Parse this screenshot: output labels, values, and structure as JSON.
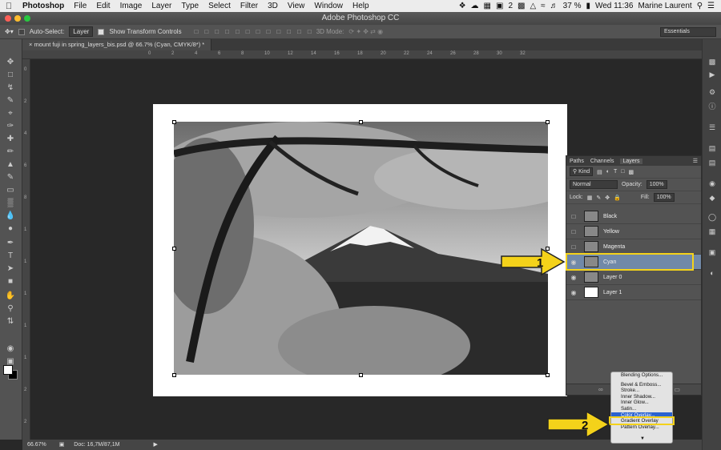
{
  "menubar": {
    "app": "Photoshop",
    "items": [
      "File",
      "Edit",
      "Image",
      "Layer",
      "Type",
      "Select",
      "Filter",
      "3D",
      "View",
      "Window",
      "Help"
    ],
    "battery": "37 %",
    "clock": "Wed 11:36",
    "user": "Marine Laurent",
    "badge": "2"
  },
  "window": {
    "title": "Adobe Photoshop CC"
  },
  "options": {
    "auto_select": "Auto-Select:",
    "layer_select": "Layer",
    "transform_controls": "Show Transform Controls",
    "mode_3d": "3D Mode:",
    "workspace": "Essentials"
  },
  "document": {
    "tab": "mount fuji in spring_layers_bis.psd @ 66.7% (Cyan, CMYK/8*) *",
    "zoom": "66.67%",
    "doc_size": "Doc: 16,7M/87,1M"
  },
  "ruler": {
    "top": [
      "0",
      "2",
      "4",
      "6",
      "8",
      "10",
      "12",
      "14",
      "16",
      "18",
      "20",
      "22",
      "24",
      "26",
      "28",
      "30",
      "32"
    ],
    "left": [
      "0",
      "2",
      "4",
      "6",
      "8",
      "1",
      "1",
      "1",
      "1",
      "1",
      "2",
      "2"
    ]
  },
  "layers_panel": {
    "tabs": [
      "Paths",
      "Channels",
      "Layers"
    ],
    "kind": "Kind",
    "blend_mode": "Normal",
    "opacity_label": "Opacity:",
    "opacity": "100%",
    "lock_label": "Lock:",
    "fill_label": "Fill:",
    "fill": "100%",
    "layers": [
      {
        "name": "Black",
        "visible": false,
        "selected": false
      },
      {
        "name": "Yellow",
        "visible": false,
        "selected": false
      },
      {
        "name": "Magenta",
        "visible": false,
        "selected": false
      },
      {
        "name": "Cyan",
        "visible": true,
        "selected": true
      },
      {
        "name": "Layer 0",
        "visible": true,
        "selected": false
      },
      {
        "name": "Layer 1",
        "visible": true,
        "selected": false
      }
    ]
  },
  "context_menu": {
    "items": [
      "Blending Options...",
      "Bevel & Emboss...",
      "Stroke...",
      "Inner Shadow...",
      "Inner Glow...",
      "Satin...",
      "Color Overlay...",
      "Gradient Overlay",
      "Pattern Overlay..."
    ],
    "selected": "Color Overlay..."
  },
  "callouts": {
    "one": "1",
    "two": "2"
  },
  "colors": {
    "highlight": "#f4d21a",
    "selected_layer": "#7189a8",
    "menu_selected": "#2a62d0"
  }
}
